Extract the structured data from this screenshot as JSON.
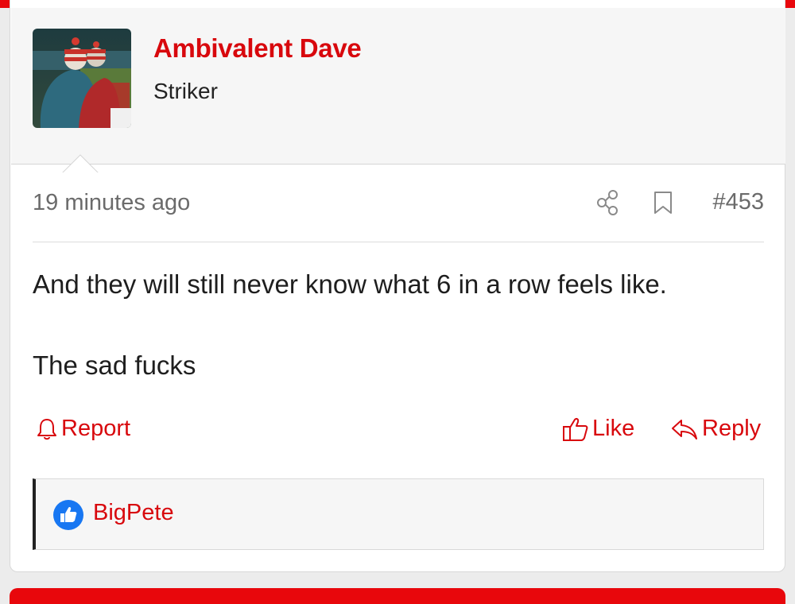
{
  "post": {
    "author": "Ambivalent Dave",
    "author_title": "Striker",
    "timestamp": "19 minutes ago",
    "post_number": "#453",
    "body": [
      "And they will still never know what 6 in a row feels like.",
      "The sad fucks"
    ],
    "actions": {
      "report": "Report",
      "like": "Like",
      "reply": "Reply"
    },
    "reactions": {
      "users": [
        "BigPete"
      ]
    }
  },
  "colors": {
    "accent": "#e8070c",
    "link": "#d8080d",
    "reaction_blue": "#1877f2"
  },
  "icons": [
    "share-icon",
    "bookmark-icon",
    "bell-icon",
    "thumbs-up-icon",
    "reply-arrow-icon",
    "like-reaction-icon"
  ]
}
